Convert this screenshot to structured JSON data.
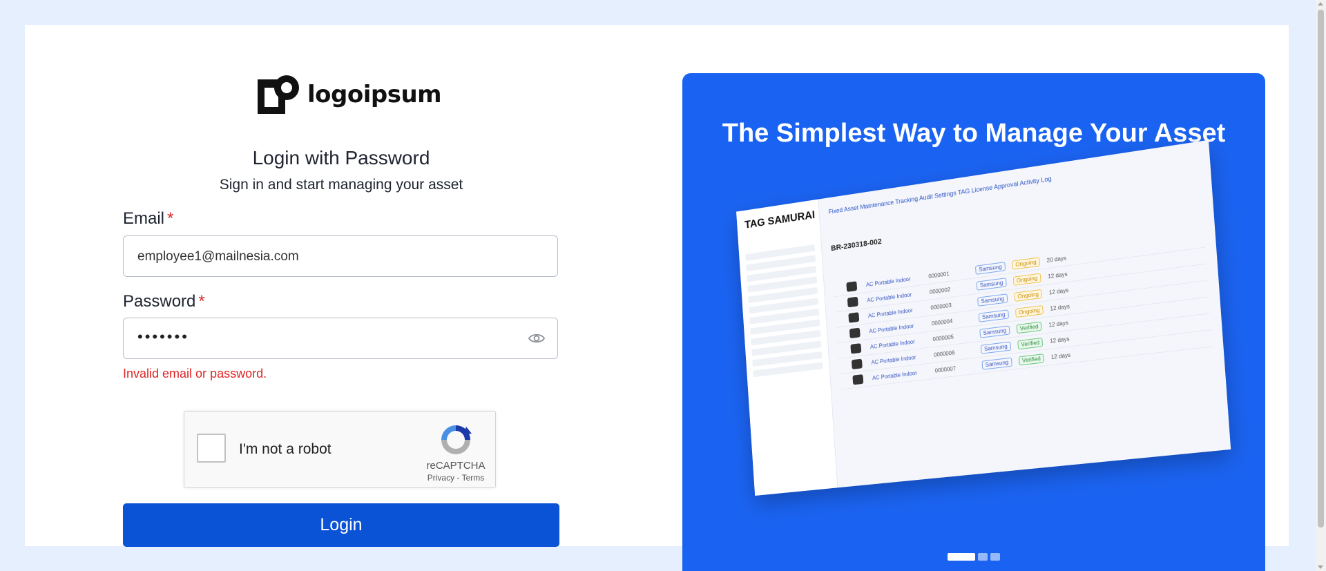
{
  "brand": {
    "logo_text": "logoipsum"
  },
  "login": {
    "title": "Login with Password",
    "subtitle": "Sign in and start managing your asset",
    "email_label": "Email",
    "required_mark": "*",
    "email_value": "employee1@mailnesia.com",
    "password_label": "Password",
    "password_masked": "•••••••",
    "error": "Invalid email or password.",
    "button": "Login"
  },
  "recaptcha": {
    "label": "I'm not a robot",
    "brand": "reCAPTCHA",
    "privacy": "Privacy",
    "separator": " - ",
    "terms": "Terms"
  },
  "promo": {
    "title": "The Simplest Way to Manage Your Asset",
    "mockup_brand": "TAG SAMURAI",
    "mockup_nav": "Fixed Asset   Maintenance   Tracking   Audit   Settings   TAG   License   Approval   Activity Log",
    "mockup_heading": "BR-230318-002",
    "mockup_rows": [
      {
        "name": "AC Portable Indoor",
        "id": "0000001",
        "tag1": "Samsung",
        "tag2": "Ongoing",
        "days": "20 days"
      },
      {
        "name": "AC Portable Indoor",
        "id": "0000002",
        "tag1": "Samsung",
        "tag2": "Ongoing",
        "days": "12 days"
      },
      {
        "name": "AC Portable Indoor",
        "id": "0000003",
        "tag1": "Samsung",
        "tag2": "Ongoing",
        "days": "12 days"
      },
      {
        "name": "AC Portable Indoor",
        "id": "0000004",
        "tag1": "Samsung",
        "tag2": "Ongoing",
        "days": "12 days"
      },
      {
        "name": "AC Portable Indoor",
        "id": "0000005",
        "tag1": "Samsung",
        "tag2": "Verified",
        "days": "12 days"
      },
      {
        "name": "AC Portable Indoor",
        "id": "0000006",
        "tag1": "Samsung",
        "tag2": "Verified",
        "days": "12 days"
      },
      {
        "name": "AC Portable Indoor",
        "id": "0000007",
        "tag1": "Samsung",
        "tag2": "Verified",
        "days": "12 days"
      }
    ],
    "carousel_slides": 3,
    "carousel_active": 0
  },
  "colors": {
    "page_bg": "#e5effd",
    "primary": "#0a52d6",
    "promo_bg": "#1a63f2",
    "error": "#e02424"
  }
}
